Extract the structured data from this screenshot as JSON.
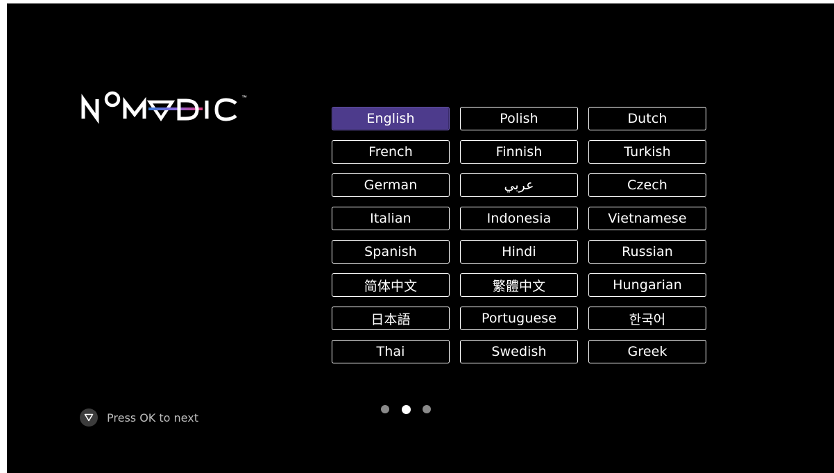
{
  "brand": {
    "logo_text": "NOMVDIC",
    "trademark": "™",
    "logo_colors": {
      "text": "#ffffff",
      "gradient_start": "#3a7bd5",
      "gradient_end": "#d63a7a"
    }
  },
  "languages": [
    {
      "label": "English",
      "selected": true
    },
    {
      "label": "Polish",
      "selected": false
    },
    {
      "label": "Dutch",
      "selected": false
    },
    {
      "label": "French",
      "selected": false
    },
    {
      "label": "Finnish",
      "selected": false
    },
    {
      "label": "Turkish",
      "selected": false
    },
    {
      "label": "German",
      "selected": false
    },
    {
      "label": "عربي",
      "selected": false
    },
    {
      "label": "Czech",
      "selected": false
    },
    {
      "label": "Italian",
      "selected": false
    },
    {
      "label": "Indonesia",
      "selected": false
    },
    {
      "label": "Vietnamese",
      "selected": false
    },
    {
      "label": "Spanish",
      "selected": false
    },
    {
      "label": "Hindi",
      "selected": false
    },
    {
      "label": "Russian",
      "selected": false
    },
    {
      "label": "简体中文",
      "selected": false
    },
    {
      "label": "繁體中文",
      "selected": false
    },
    {
      "label": "Hungarian",
      "selected": false
    },
    {
      "label": "日本語",
      "selected": false
    },
    {
      "label": "Portuguese",
      "selected": false
    },
    {
      "label": "한국어",
      "selected": false
    },
    {
      "label": "Thai",
      "selected": false
    },
    {
      "label": "Swedish",
      "selected": false
    },
    {
      "label": "Greek",
      "selected": false
    }
  ],
  "pagination": {
    "page_count": 3,
    "current_page": 2
  },
  "hint": {
    "icon": "down-triangle-icon",
    "text": "Press OK to next"
  },
  "colors": {
    "background": "#000000",
    "selected_fill": "#4d3b8c",
    "button_border": "#ffffff",
    "dot_inactive": "#8a8a8a",
    "dot_active": "#ffffff"
  }
}
